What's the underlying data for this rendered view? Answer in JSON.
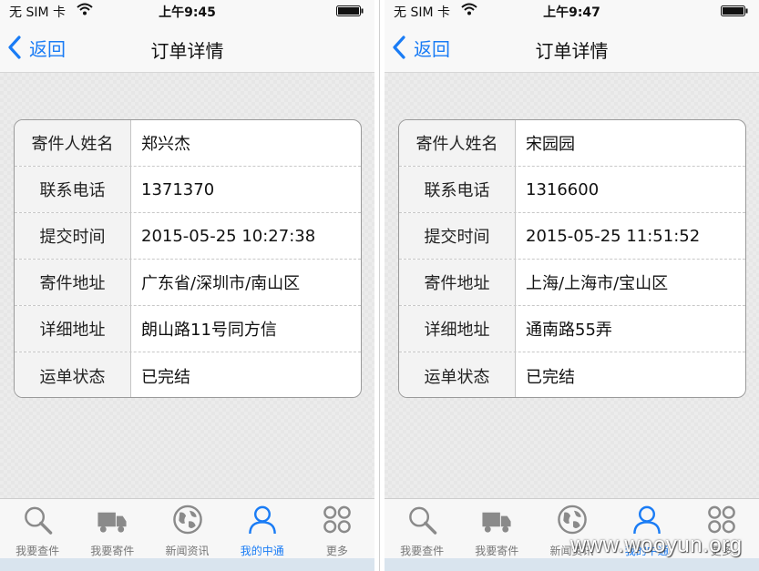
{
  "colors": {
    "accent": "#1a7cf5",
    "tab_inactive": "#777777",
    "card_border": "#9a9a9a"
  },
  "screens": [
    {
      "status": {
        "carrier": "无 SIM 卡",
        "time": "上午9:45"
      },
      "nav": {
        "back_label": "返回",
        "title": "订单详情"
      },
      "details": [
        {
          "label": "寄件人姓名",
          "value": "郑兴杰"
        },
        {
          "label": "联系电话",
          "value": "1371370"
        },
        {
          "label": "提交时间",
          "value": "2015-05-25 10:27:38"
        },
        {
          "label": "寄件地址",
          "value": "广东省/深圳市/南山区"
        },
        {
          "label": "详细地址",
          "value": "朗山路11号同方信"
        },
        {
          "label": "运单状态",
          "value": "已完结"
        }
      ],
      "tabs": [
        {
          "label": "我要查件",
          "icon": "search-icon"
        },
        {
          "label": "我要寄件",
          "icon": "truck-icon"
        },
        {
          "label": "新闻资讯",
          "icon": "globe-icon"
        },
        {
          "label": "我的中通",
          "icon": "user-icon",
          "active": true
        },
        {
          "label": "更多",
          "icon": "more-icon"
        }
      ]
    },
    {
      "status": {
        "carrier": "无 SIM 卡",
        "time": "上午9:47"
      },
      "nav": {
        "back_label": "返回",
        "title": "订单详情"
      },
      "details": [
        {
          "label": "寄件人姓名",
          "value": "宋园园"
        },
        {
          "label": "联系电话",
          "value": "1316600"
        },
        {
          "label": "提交时间",
          "value": "2015-05-25 11:51:52"
        },
        {
          "label": "寄件地址",
          "value": "上海/上海市/宝山区"
        },
        {
          "label": "详细地址",
          "value": "通南路55弄"
        },
        {
          "label": "运单状态",
          "value": "已完结"
        }
      ],
      "tabs": [
        {
          "label": "我要查件",
          "icon": "search-icon"
        },
        {
          "label": "我要寄件",
          "icon": "truck-icon"
        },
        {
          "label": "新闻资讯",
          "icon": "globe-icon"
        },
        {
          "label": "我的中通",
          "icon": "user-icon",
          "active": true
        },
        {
          "label": "更多",
          "icon": "more-icon"
        }
      ]
    }
  ],
  "watermark": "www.wooyun.org"
}
